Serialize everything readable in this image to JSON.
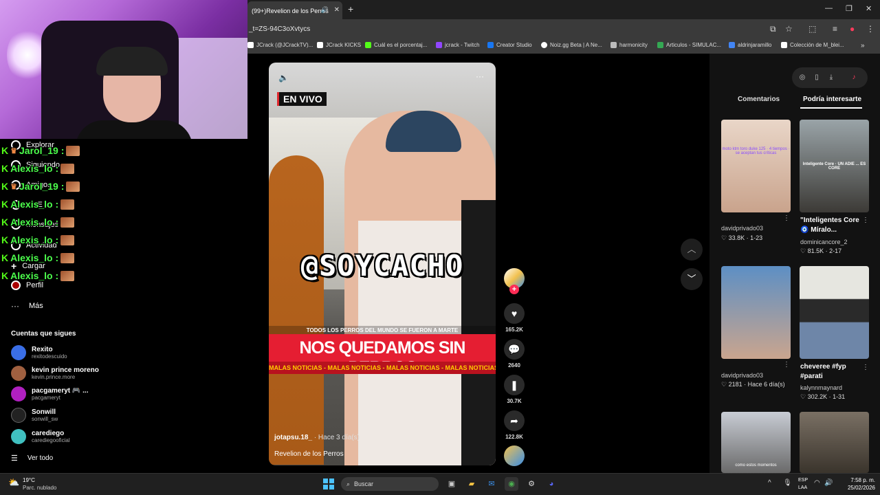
{
  "browser": {
    "tab_title": "(99+)Revelion de los Perros",
    "url": "_t=ZS-94C3oXvtycs",
    "bookmarks": [
      {
        "label": "JCrack (@JCrackTV)...",
        "color": "#ffffff"
      },
      {
        "label": "JCrack KICKS",
        "color": "#ffffff"
      },
      {
        "label": "Cuál es el porcentaj...",
        "color": "#53fc18"
      },
      {
        "label": "jcrack - Twitch",
        "color": "#9146ff"
      },
      {
        "label": "Creator Studio",
        "color": "#1877f2"
      },
      {
        "label": "Noiz.gg Beta | A Ne...",
        "color": "#ffffff"
      },
      {
        "label": "harmonicity",
        "color": "#bbbbbb"
      },
      {
        "label": "Articulos - SIMULAC...",
        "color": "#34a853"
      },
      {
        "label": "aldrinjaramillo",
        "color": "#4285f4"
      },
      {
        "label": "Colección de M_blei...",
        "color": "#ffffff"
      }
    ]
  },
  "sidebar": {
    "items": [
      {
        "label": "Explorar"
      },
      {
        "label": "Siguiendo"
      },
      {
        "label": "Amigos"
      },
      {
        "label": "LIVE"
      },
      {
        "label": "Mensajes"
      },
      {
        "label": "Actividad"
      },
      {
        "label": "Cargar"
      },
      {
        "label": "Perfil"
      },
      {
        "label": "Más"
      }
    ],
    "following_title": "Cuentas que sigues",
    "accounts": [
      {
        "name": "Rexito",
        "handle": "rexitodescuido",
        "color": "#3a6ee6"
      },
      {
        "name": "kevin prince moreno",
        "handle": "kevin.prince.more",
        "color": "#a06040"
      },
      {
        "name": "pacgameryt 🎮 ...",
        "handle": "pacgameryt",
        "color": "#b020c0"
      },
      {
        "name": "Sonwill",
        "handle": "sonwill_sw",
        "color": "#222222"
      },
      {
        "name": "carediego",
        "handle": "carediegooficial",
        "color": "#40c0c0"
      }
    ],
    "see_all": "Ver todo"
  },
  "chat": [
    {
      "user": "Jarol_19 :"
    },
    {
      "user": "Alexis_lo :"
    },
    {
      "user": "Jarol_19 :"
    },
    {
      "user": "Alexis_lo :"
    },
    {
      "user": "Alexis_lo :"
    },
    {
      "user": "Alexis_lo :"
    },
    {
      "user": "Alexis_lo :"
    },
    {
      "user": "Alexis_lo :"
    }
  ],
  "video": {
    "live_badge": "EN VIVO",
    "overlay_handle": "@SOYCACHO",
    "subheadline": "TODOS LOS PERROS DEL MUNDO SE FUERON A MARTE",
    "headline": "NOS QUEDAMOS SIN PERROS",
    "ticker": "MALAS NOTICIAS - MALAS NOTICIAS - MALAS NOTICIAS - MALAS NOTICIAS - MALAS NOTICIAS",
    "author": "jotapsu.18_",
    "time_ago": "· Hace 3 día(s)",
    "caption": "Revelion de los Perros"
  },
  "actions": {
    "likes": "165.2K",
    "comments": "2640",
    "saves": "30.7K",
    "shares": "122.8K"
  },
  "panel": {
    "tab_comments": "Comentarios",
    "tab_suggested": "Podría interesarte",
    "cards": [
      {
        "title": "",
        "user": "davidprivado03",
        "meta": "♡ 33.8K · 1-23",
        "thumb_text": "moto ktm toro duke 125 · 4 tiempos · se aceptan tus críticas",
        "c1": "#e9d6c8",
        "c2": "#c9a38c"
      },
      {
        "title": "\"Inteligentes Core 🧿 Míralo...",
        "user": "dominicancore_2",
        "meta": "♡ 81.5K · 2-17",
        "thumb_text": "Inteligente Core · UN ADIE ... ES CORE",
        "c1": "#9aa4a8",
        "c2": "#3c3a36"
      },
      {
        "title": "",
        "user": "davidprivado03",
        "meta": "♡ 2181 · Hace 6 día(s)",
        "thumb_text": "",
        "c1": "#5d8fc4",
        "c2": "#caa58e"
      },
      {
        "title": "cheveree #fyp #parati",
        "user": "kalynnmaynard",
        "meta": "♡ 302.2K · 1-31",
        "thumb_text": "",
        "c1": "#e6e6e0",
        "c2": "#2a2a2a"
      },
      {
        "title": "",
        "user": "",
        "meta": "",
        "thumb_text": "como estos momentos",
        "c1": "#c8ccd4",
        "c2": "#6a6a6a"
      },
      {
        "title": "",
        "user": "",
        "meta": "",
        "thumb_text": "",
        "c1": "#7a7064",
        "c2": "#3a342c"
      }
    ]
  },
  "taskbar": {
    "temp": "19°C",
    "condition": "Parc. nublado",
    "search_placeholder": "Buscar",
    "lang1": "ESP",
    "lang2": "LAA",
    "time": "7:58 p. m.",
    "date": "25/02/2026"
  }
}
